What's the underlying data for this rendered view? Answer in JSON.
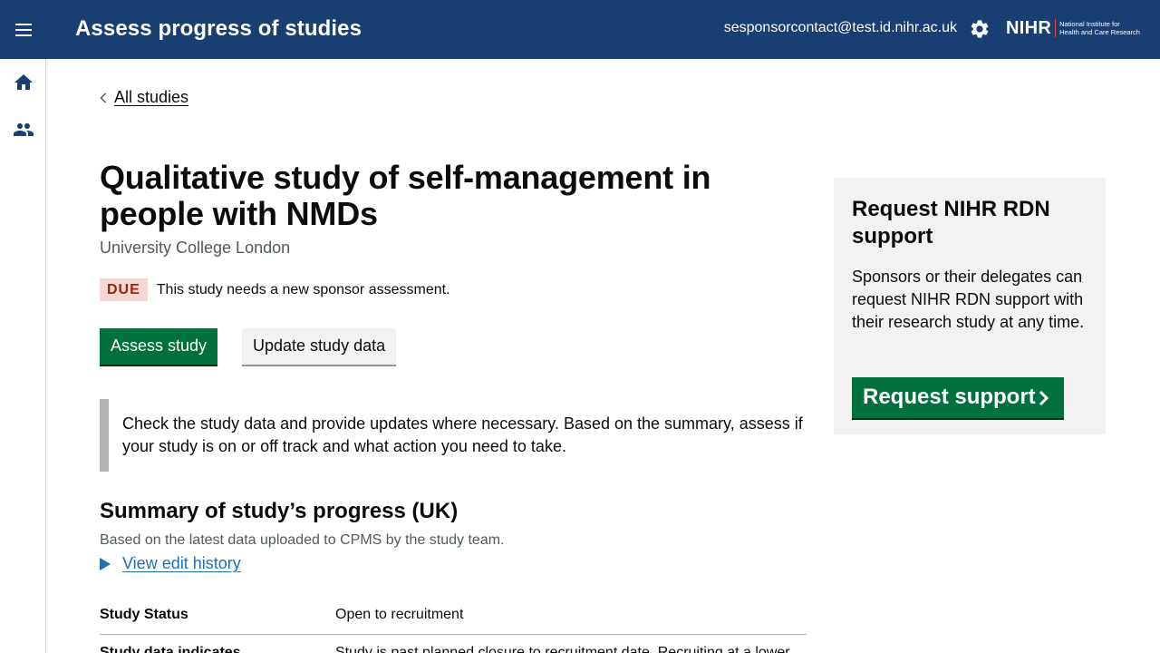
{
  "header": {
    "title": "Assess progress of studies",
    "user_email": "sesponsorcontact@test.id.nihr.ac.uk",
    "logo_text": "NIHR",
    "logo_sub_line1": "National Institute for",
    "logo_sub_line2": "Health and Care Research",
    "menu_icon": "hamburger-menu-icon",
    "settings_icon": "gear-icon"
  },
  "sidebar": {
    "items": [
      {
        "icon": "home-icon"
      },
      {
        "icon": "people-icon"
      }
    ]
  },
  "breadcrumb": {
    "back_label": "All studies"
  },
  "study": {
    "title": "Qualitative study of self-management in people with NMDs",
    "organisation": "University College London",
    "status_tag": "DUE",
    "status_message": "This study needs a new sponsor assessment."
  },
  "actions": {
    "assess_label": "Assess study",
    "update_label": "Update study data"
  },
  "inset_text": "Check the study data and provide updates where necessary. Based on the summary, assess if your study is on or off track and what action you need to take.",
  "summary": {
    "title": "Summary of study’s progress (UK)",
    "subtitle": "Based on the latest data uploaded to CPMS by the study team.",
    "history_link": "View edit history",
    "rows": [
      {
        "key": "Study Status",
        "value": "Open to recruitment"
      },
      {
        "key": "Study data indicates",
        "value": "Study is past planned closure to recruitment date. Recruiting at a lower"
      }
    ]
  },
  "side_panel": {
    "title": "Request NIHR RDN support",
    "text": "Sponsors or their delegates can request NIHR RDN support with their research study at any time.",
    "button_label": "Request support"
  },
  "colors": {
    "header_bg": "#193e72",
    "primary_green": "#00703c",
    "due_tag_bg": "#f6d7d2",
    "due_tag_text": "#942514",
    "link_blue": "#1d70b8"
  }
}
